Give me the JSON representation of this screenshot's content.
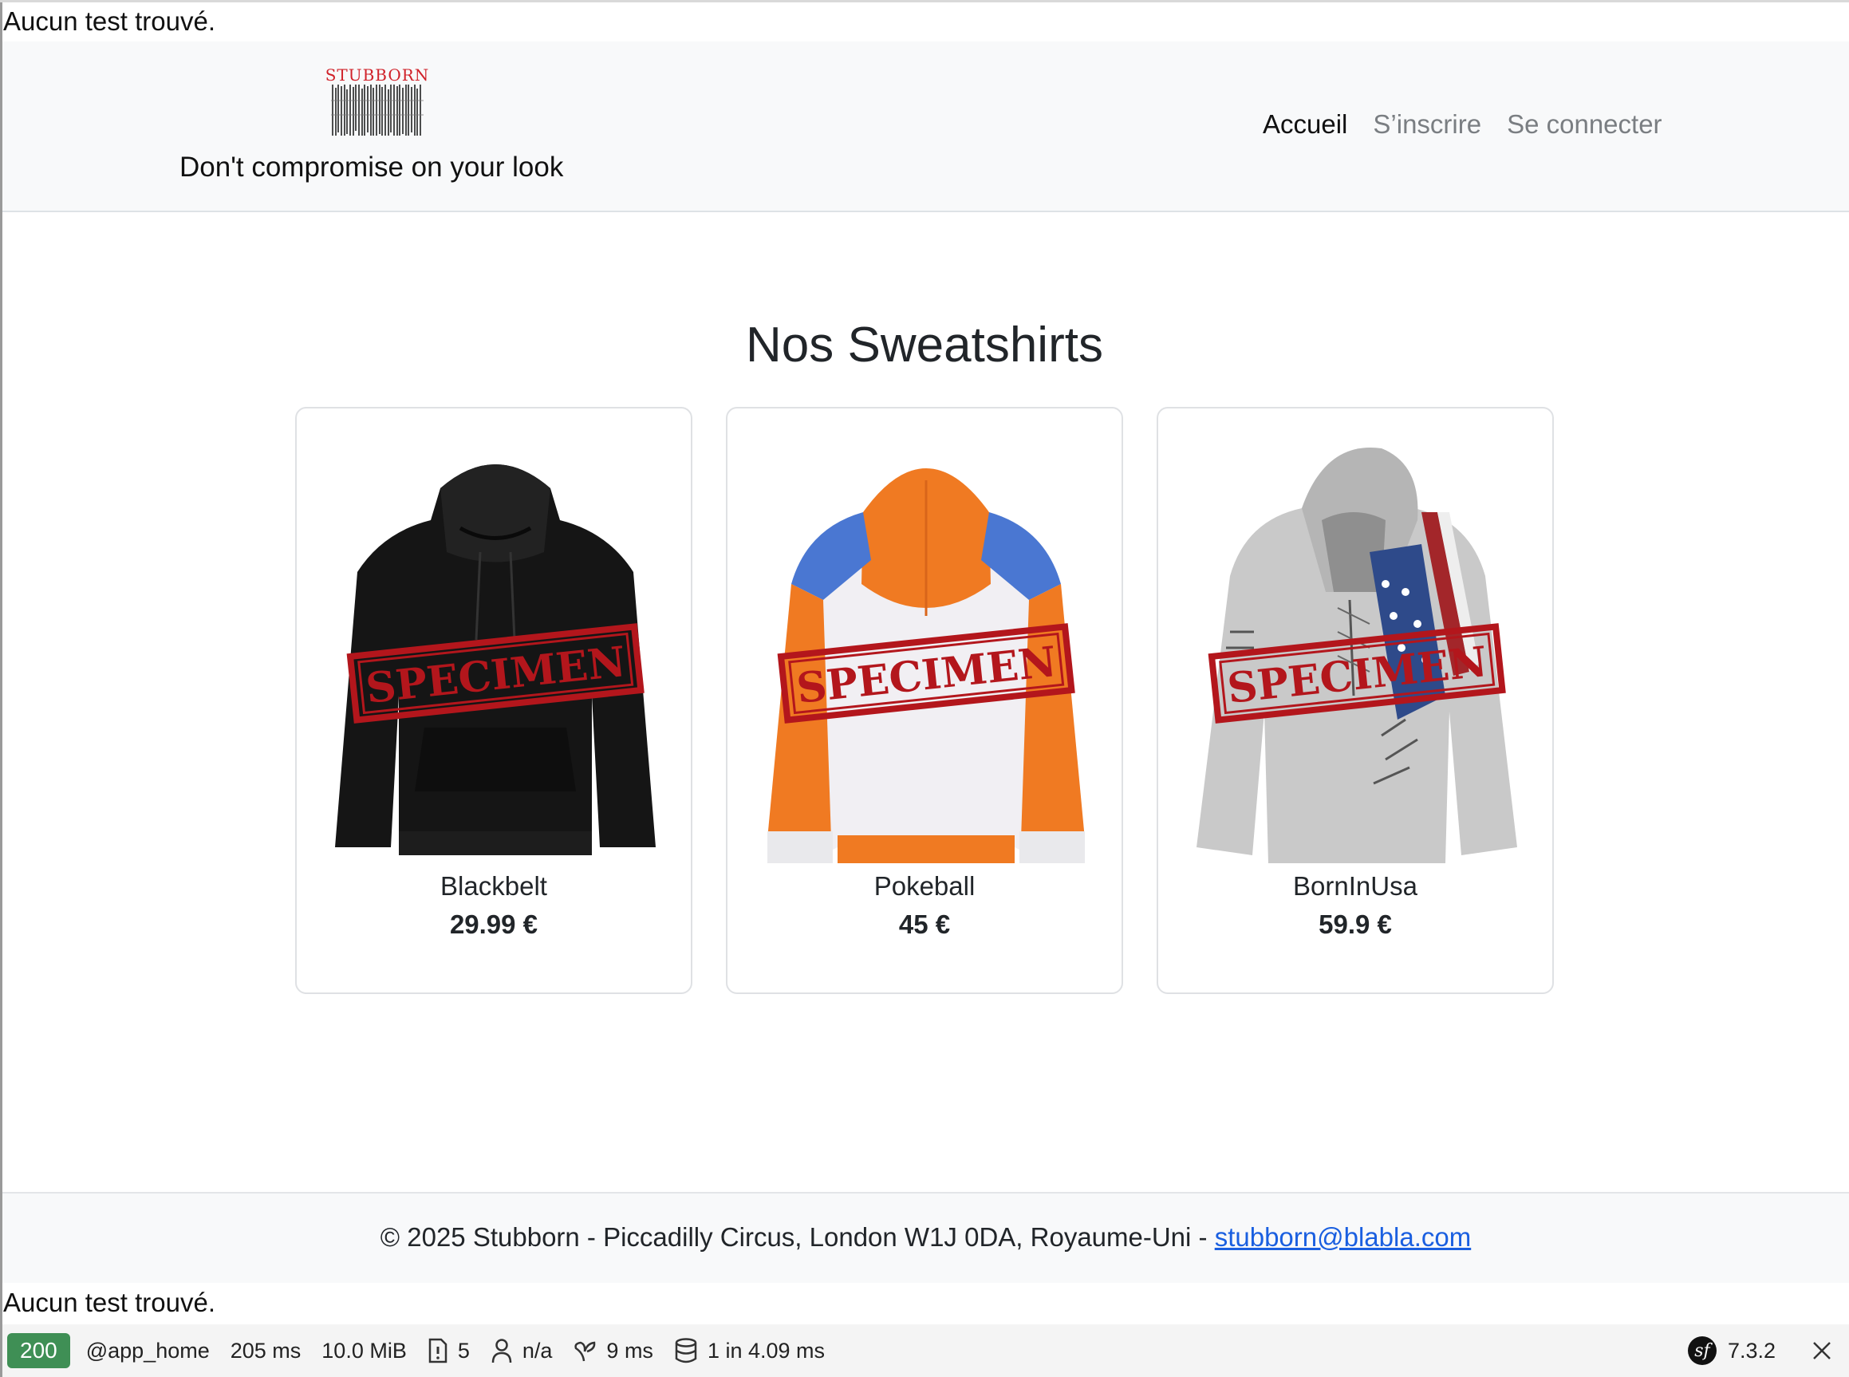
{
  "notices": {
    "top": "Aucun test trouvé.",
    "bottom": "Aucun test trouvé."
  },
  "header": {
    "logo_text": "STUBBORN",
    "tagline": "Don't compromise on your look",
    "nav": [
      {
        "label": "Accueil",
        "active": true
      },
      {
        "label": "S’inscrire",
        "active": false
      },
      {
        "label": "Se connecter",
        "active": false
      }
    ]
  },
  "main": {
    "title": "Nos Sweatshirts",
    "stamp_text": "SPECIMEN",
    "products": [
      {
        "name": "Blackbelt",
        "price": "29.99 €"
      },
      {
        "name": "Pokeball",
        "price": "45 €"
      },
      {
        "name": "BornInUsa",
        "price": "59.9 €"
      }
    ]
  },
  "footer": {
    "text": "© 2025 Stubborn - Piccadilly Circus, London W1J 0DA, Royaume-Uni - ",
    "email": "stubborn@blabla.com"
  },
  "toolbar": {
    "status": "200",
    "route": "@app_home",
    "time": "205 ms",
    "memory": "10.0 MiB",
    "logs": "5",
    "user": "n/a",
    "twig": "9 ms",
    "db": "1 in 4.09  ms",
    "version": "7.3.2",
    "icons": [
      "warning-doc-icon",
      "user-icon",
      "twig-leaf-icon",
      "database-icon",
      "symfony-logo-icon",
      "close-icon"
    ]
  },
  "colors": {
    "status_green": "#3f8f55",
    "stamp_red": "#b3161c",
    "link_blue": "#1a5fe0",
    "header_bg": "#f8f9fa"
  }
}
